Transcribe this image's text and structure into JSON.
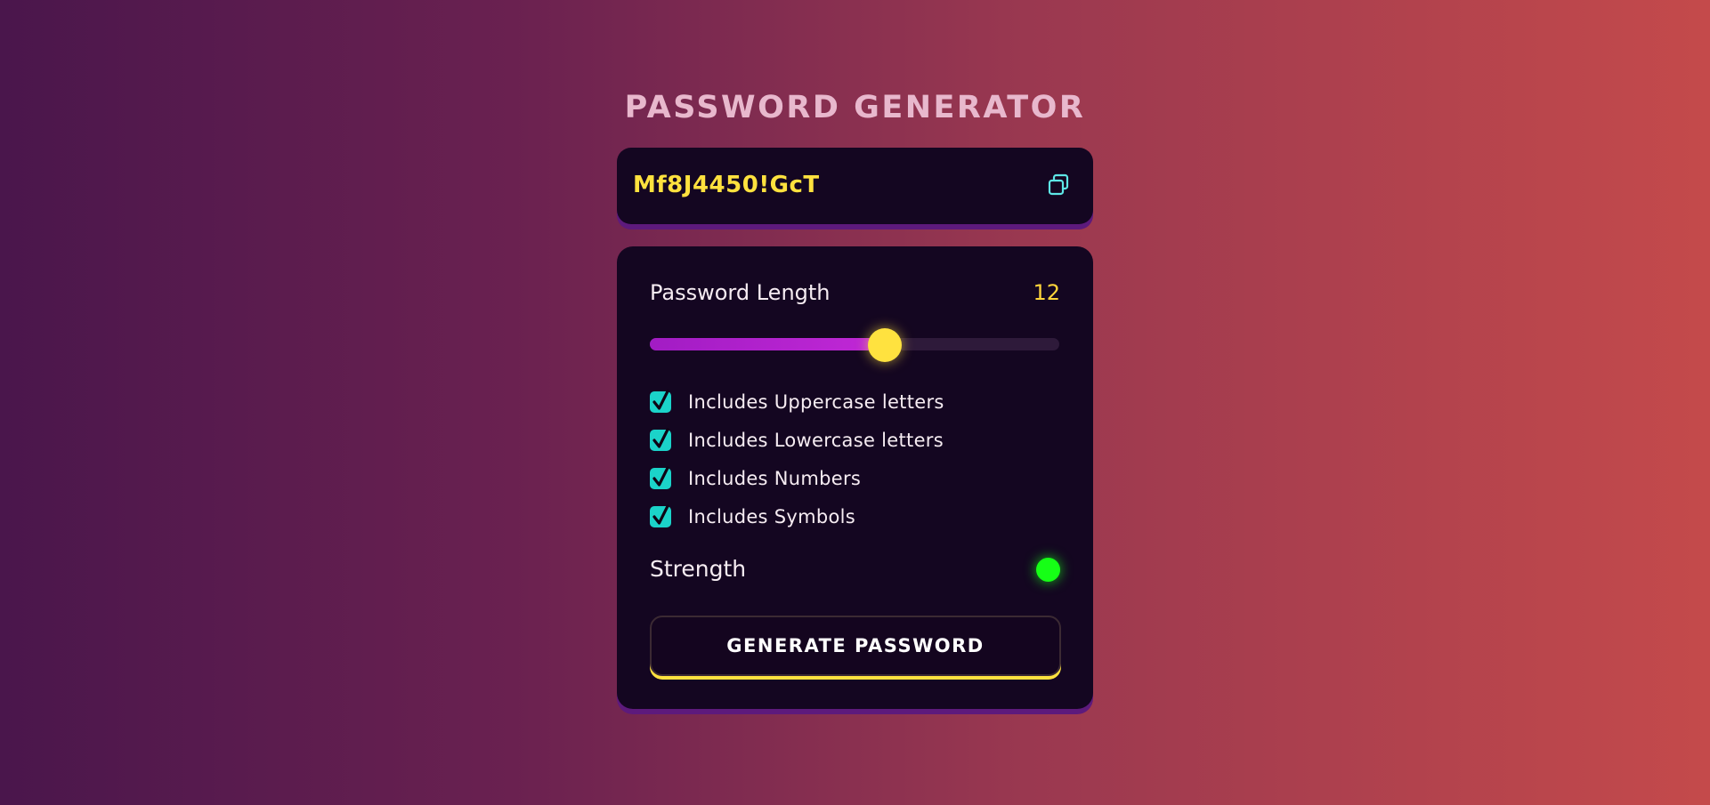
{
  "app": {
    "title": "PASSWORD GENERATOR"
  },
  "display": {
    "password": "Mf8J4450!GcT",
    "copy_icon": "copy-icon"
  },
  "length": {
    "label": "Password Length",
    "value": "12",
    "slider_fraction": 0.573
  },
  "options": [
    {
      "label": "Includes Uppercase letters",
      "checked": true
    },
    {
      "label": "Includes Lowercase letters",
      "checked": true
    },
    {
      "label": "Includes Numbers",
      "checked": true
    },
    {
      "label": "Includes Symbols",
      "checked": true
    }
  ],
  "strength": {
    "label": "Strength",
    "indicator_color": "#16ff16"
  },
  "generate": {
    "label": "GENERATE PASSWORD"
  },
  "colors": {
    "accent_yellow": "#ffe23f",
    "checkbox_teal": "#1bd3c9",
    "slider_purple": "#b124cf",
    "panel_bg": "#140621"
  }
}
